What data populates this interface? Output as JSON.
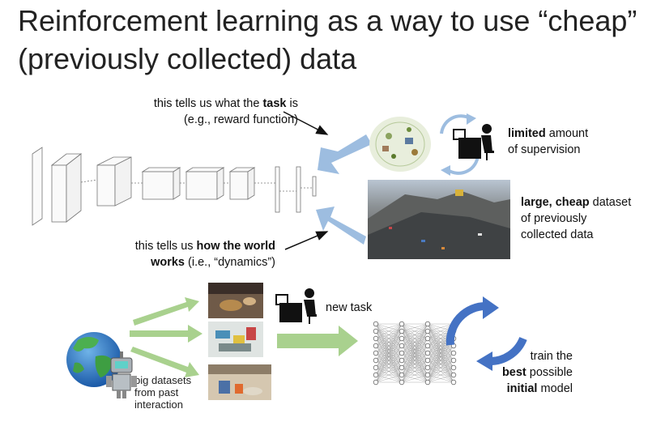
{
  "title": "Reinforcement learning as a way to use “cheap” (previously collected) data",
  "task_note": {
    "line1_a": "this tells us what the ",
    "line1_b": "task",
    "line1_c": " is",
    "line2": "(e.g., reward function)"
  },
  "dynamics_note": {
    "line1_a": "this tells us ",
    "line1_b": "how the world",
    "line2_b": "works",
    "line2_c": " (i.e., “dynamics”)"
  },
  "supervision": {
    "line1_b": "limited",
    "line1_c": " amount",
    "line2": "of supervision"
  },
  "dataset": {
    "line1_b": "large, cheap",
    "line1_c": " dataset",
    "line2": "of previously",
    "line3": "collected data"
  },
  "new_task": "new task",
  "big_datasets": {
    "line1": "big datasets",
    "line2": "from past",
    "line3": "interaction"
  },
  "train": {
    "line1": "train the",
    "line2_b": "best",
    "line2_c": " possible",
    "line3_b": "initial",
    "line3_c": " model"
  },
  "colors": {
    "blue_arrow": "#9dbde0",
    "green_arrow": "#a9d18e",
    "cycle_blue": "#4472c4"
  }
}
